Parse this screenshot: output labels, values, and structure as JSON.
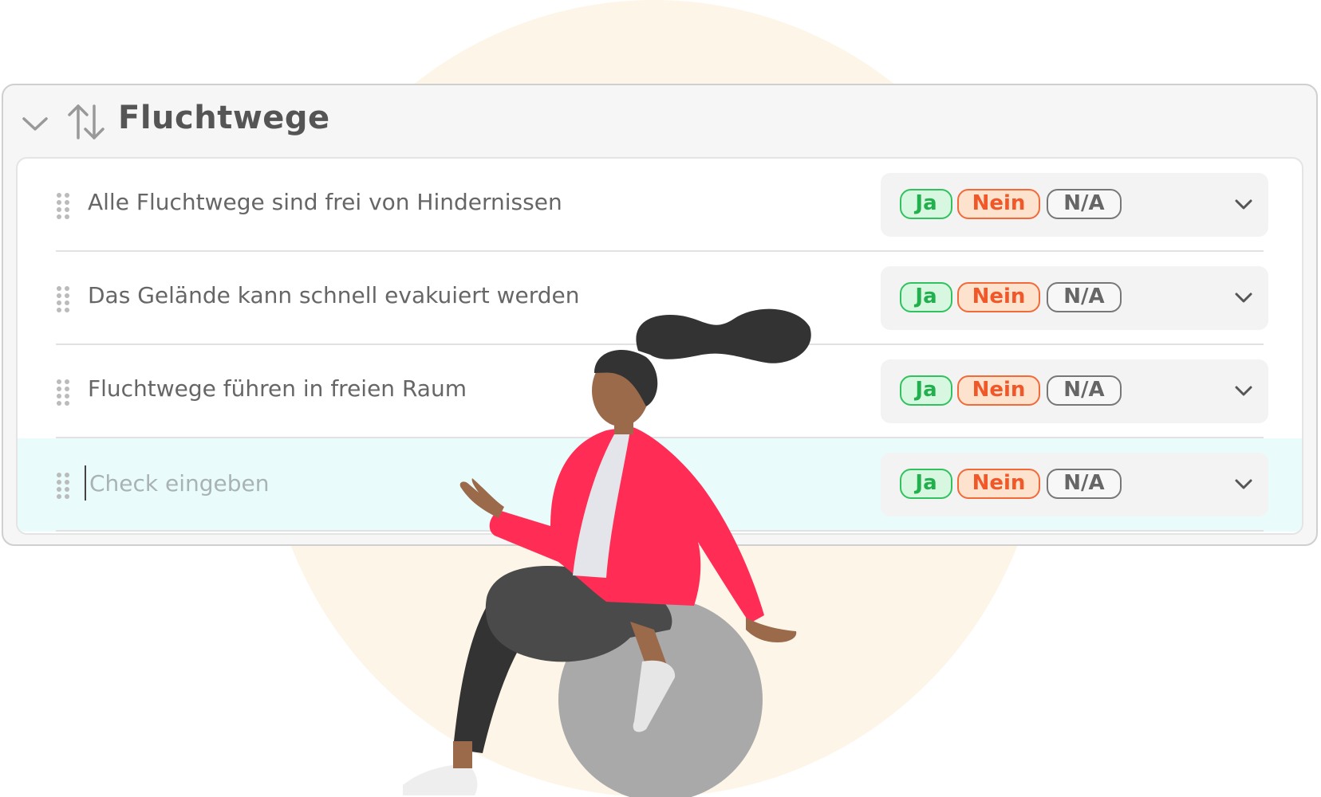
{
  "section": {
    "title": "Fluchtwege",
    "collapse_icon": "chevron-down-icon",
    "sort_icon": "sort-arrows-icon"
  },
  "checks": [
    {
      "text": "Alle Fluchtwege sind frei von Hindernissen"
    },
    {
      "text": "Das Gelände kann schnell evakuiert werden"
    },
    {
      "text": "Fluchtwege führen in freien Raum"
    }
  ],
  "new_check": {
    "value": "",
    "placeholder": "Check eingeben"
  },
  "answers": {
    "yes": "Ja",
    "no": "Nein",
    "na": "N/A"
  },
  "colors": {
    "yes": "#31c25f",
    "no": "#f26a3a",
    "na": "#777777",
    "active_row": "#e9fbfb",
    "background_blob": "#fdf6e8"
  },
  "illustration": "woman-sitting-on-exercise-ball-illustration"
}
